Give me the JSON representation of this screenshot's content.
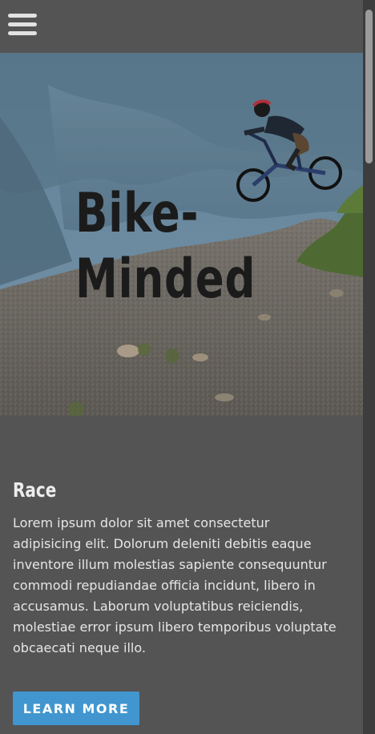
{
  "header": {
    "menu_icon": "hamburger-menu-icon"
  },
  "hero": {
    "title_line1": "Bike-",
    "title_line2": "Minded"
  },
  "section": {
    "heading": "Race",
    "body": "Lorem ipsum dolor sit amet consectetur adipisicing elit. Dolorum deleniti debitis eaque inventore illum molestias sapiente consequuntur commodi repudiandae officia incidunt, libero in accusamus. Laborum voluptatibus reiciendis, molestiae error ipsum libero temporibus voluptate obcaecati neque illo.",
    "button_label": "LEARN MORE"
  },
  "colors": {
    "background": "#545454",
    "button": "#4196cf",
    "heading_text": "#ececec",
    "hero_title": "#1b1b1b"
  }
}
